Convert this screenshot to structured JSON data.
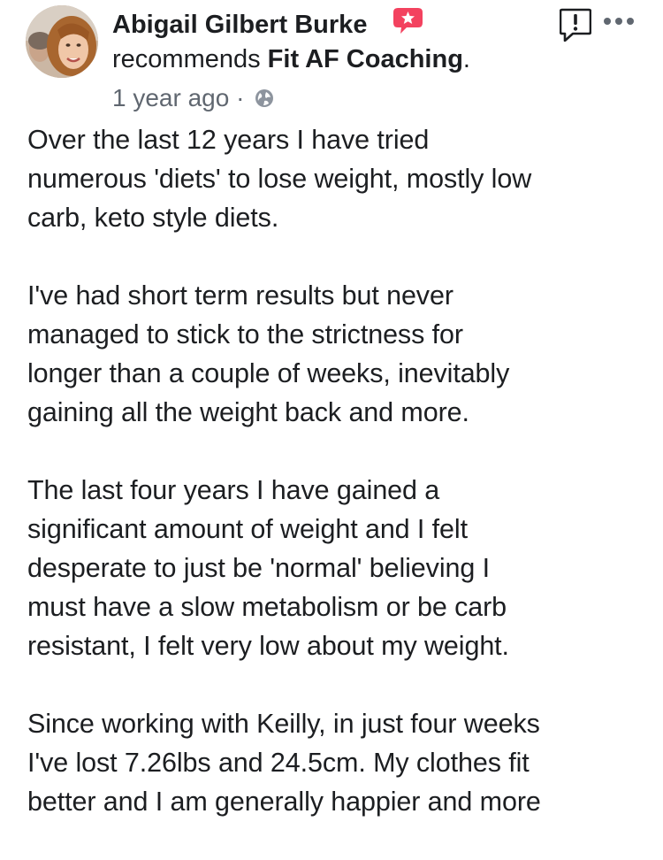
{
  "post": {
    "author_name": "Abigail Gilbert Burke",
    "recommends_prefix": "recommends ",
    "page_name": "Fit AF Coaching",
    "recommends_suffix": ".",
    "timestamp": "1 year ago",
    "separator": " · ",
    "privacy_icon": "globe-icon",
    "recommend_badge_icon": "recommend-star-badge-icon",
    "report_icon": "report-flag-icon",
    "more_icon": "more-options-icon",
    "badge_color": "#f3425f",
    "paragraphs": [
      [
        "Over the last 12 years I have tried",
        "numerous 'diets' to lose weight, mostly low",
        "carb, keto style diets."
      ],
      [
        "I've had short term results but never",
        "managed to stick to the strictness for",
        "longer than a couple of weeks, inevitably",
        "gaining all the weight back and more."
      ],
      [
        "The last four years I have gained a",
        "significant amount of weight and I felt",
        "desperate to just be 'normal' believing I",
        "must have a slow metabolism or be carb",
        "resistant, I felt very low about my weight."
      ],
      [
        "Since working with Keilly, in just four weeks",
        "I've lost 7.26lbs and 24.5cm. My clothes fit",
        "better and I am generally happier and more"
      ]
    ]
  }
}
